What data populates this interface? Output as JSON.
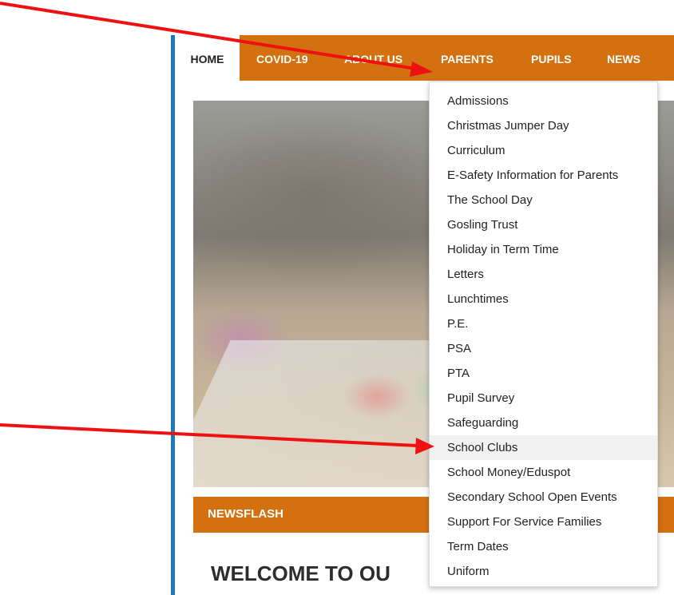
{
  "nav": {
    "items": [
      {
        "label": "HOME"
      },
      {
        "label": "COVID-19"
      },
      {
        "label": "ABOUT US"
      },
      {
        "label": "PARENTS"
      },
      {
        "label": "PUPILS"
      },
      {
        "label": "NEWS"
      }
    ]
  },
  "dropdown": {
    "items": [
      {
        "label": "Admissions"
      },
      {
        "label": "Christmas Jumper Day"
      },
      {
        "label": "Curriculum"
      },
      {
        "label": "E-Safety Information for Parents"
      },
      {
        "label": "The School Day"
      },
      {
        "label": "Gosling Trust"
      },
      {
        "label": "Holiday in Term Time"
      },
      {
        "label": "Letters"
      },
      {
        "label": "Lunchtimes"
      },
      {
        "label": "P.E."
      },
      {
        "label": "PSA"
      },
      {
        "label": "PTA"
      },
      {
        "label": "Pupil Survey"
      },
      {
        "label": "Safeguarding"
      },
      {
        "label": "School Clubs"
      },
      {
        "label": "School Money/Eduspot"
      },
      {
        "label": "Secondary School Open Events"
      },
      {
        "label": "Support For Service Families"
      },
      {
        "label": "Term Dates"
      },
      {
        "label": "Uniform"
      }
    ]
  },
  "newsflash": {
    "label": "NEWSFLASH"
  },
  "welcome": {
    "heading": "WELCOME TO OU"
  },
  "colors": {
    "nav_orange": "#d3700f",
    "left_bar_blue": "#1f7bb8",
    "arrow_red": "#ee1111"
  }
}
